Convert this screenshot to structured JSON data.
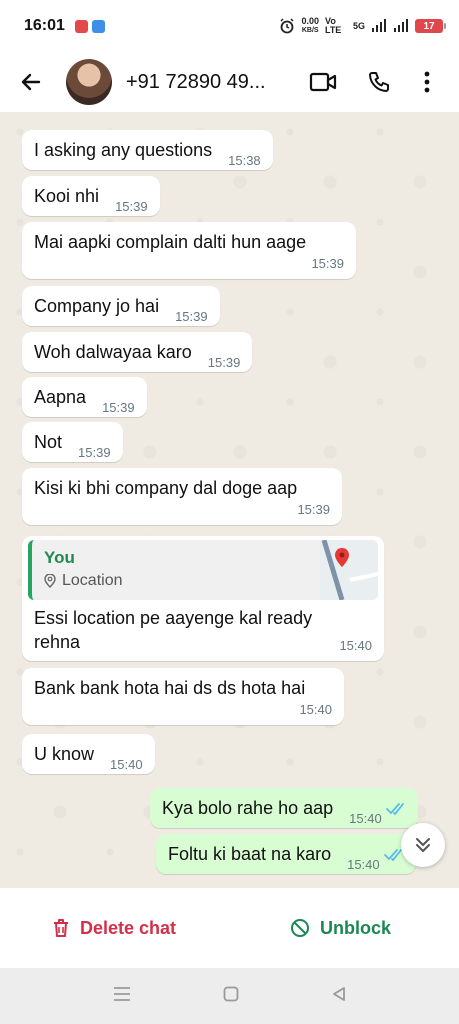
{
  "status_bar": {
    "time": "16:01",
    "speed_value": "0.00",
    "speed_unit": "KB/S",
    "net_primary": "Vo LTE",
    "net_secondary": "5G",
    "battery": "17"
  },
  "app_bar": {
    "contact_name": "+91 72890 49..."
  },
  "messages": [
    {
      "text": "I asking any questions",
      "time": "15:38"
    },
    {
      "text": "Kooi nhi",
      "time": "15:39"
    },
    {
      "text": "Mai aapki complain dalti hun aage",
      "time": "15:39"
    },
    {
      "text": "Company jo hai",
      "time": "15:39"
    },
    {
      "text": "Woh dalwayaa karo",
      "time": "15:39"
    },
    {
      "text": "Aapna",
      "time": "15:39"
    },
    {
      "text": "Not",
      "time": "15:39"
    },
    {
      "text": "Kisi ki bhi company dal doge aap",
      "time": "15:39"
    },
    {
      "reply_author": "You",
      "reply_type": "Location",
      "text_line1": "Essi location pe aayenge kal  ready",
      "text_line2": "rehna",
      "time": "15:40"
    },
    {
      "text": "Bank bank hota hai ds ds hota hai",
      "time": "15:40"
    },
    {
      "text": "U know",
      "time": "15:40"
    },
    {
      "text": "Kya bolo rahe ho aap",
      "time": "15:40"
    },
    {
      "text": "Foltu ki baat na karo",
      "time": "15:40"
    }
  ],
  "actions": {
    "delete_label": "Delete chat",
    "unblock_label": "Unblock"
  },
  "colors": {
    "incoming_bubble": "#ffffff",
    "outgoing_bubble": "#d9fdd3",
    "delete_red": "#d32f4a",
    "unblock_green": "#1b8755",
    "read_tick_blue": "#53bdeb"
  }
}
